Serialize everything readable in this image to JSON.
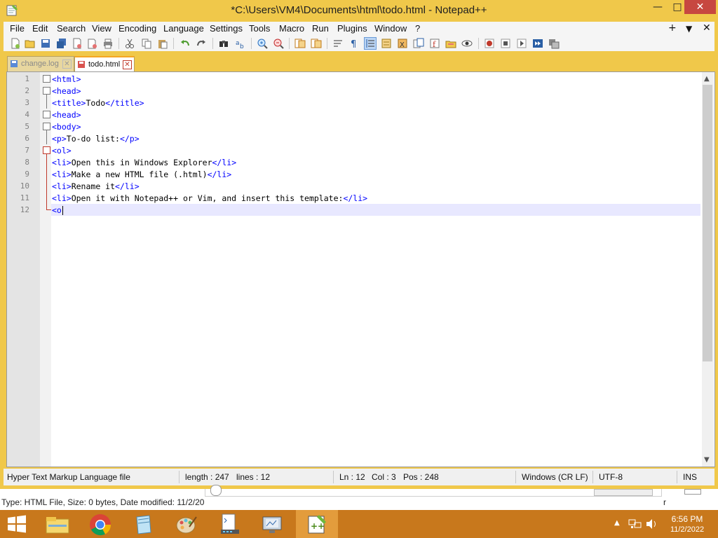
{
  "window": {
    "title": "*C:\\Users\\VM4\\Documents\\html\\todo.html - Notepad++",
    "minimize_label": "—",
    "maximize_label": "□",
    "close_label": "✕"
  },
  "menu": {
    "items": [
      "File",
      "Edit",
      "Search",
      "View",
      "Encoding",
      "Language",
      "Settings",
      "Tools",
      "Macro",
      "Run",
      "Plugins",
      "Window",
      "?"
    ],
    "right_add": "+",
    "right_dropdown": "▼",
    "right_close": "✕"
  },
  "tabs": [
    {
      "label": "change.log",
      "active": false
    },
    {
      "label": "todo.html",
      "active": true
    }
  ],
  "editor": {
    "lines": [
      {
        "num": "1",
        "parts": [
          {
            "t": "tag",
            "v": "<html>"
          }
        ]
      },
      {
        "num": "2",
        "parts": [
          {
            "t": "tag",
            "v": "<head>"
          }
        ]
      },
      {
        "num": "3",
        "parts": [
          {
            "t": "tag",
            "v": "<title>"
          },
          {
            "t": "txt",
            "v": "Todo"
          },
          {
            "t": "tag",
            "v": "</title>"
          }
        ]
      },
      {
        "num": "4",
        "parts": [
          {
            "t": "tag",
            "v": "<head>"
          }
        ]
      },
      {
        "num": "5",
        "parts": [
          {
            "t": "tag",
            "v": "<body>"
          }
        ]
      },
      {
        "num": "6",
        "parts": [
          {
            "t": "tag",
            "v": "<p>"
          },
          {
            "t": "txt",
            "v": "To-do list:"
          },
          {
            "t": "tag",
            "v": "</p>"
          }
        ]
      },
      {
        "num": "7",
        "parts": [
          {
            "t": "tag",
            "v": "<ol>"
          }
        ]
      },
      {
        "num": "8",
        "parts": [
          {
            "t": "tag",
            "v": "<li>"
          },
          {
            "t": "txt",
            "v": "Open this in Windows Explorer"
          },
          {
            "t": "tag",
            "v": "</li>"
          }
        ]
      },
      {
        "num": "9",
        "parts": [
          {
            "t": "tag",
            "v": "<li>"
          },
          {
            "t": "txt",
            "v": "Make a new HTML file (.html)"
          },
          {
            "t": "tag",
            "v": "</li>"
          }
        ]
      },
      {
        "num": "10",
        "parts": [
          {
            "t": "tag",
            "v": "<li>"
          },
          {
            "t": "txt",
            "v": "Rename it"
          },
          {
            "t": "tag",
            "v": "</li>"
          }
        ]
      },
      {
        "num": "11",
        "parts": [
          {
            "t": "tag",
            "v": "<li>"
          },
          {
            "t": "txt",
            "v": "Open it with Notepad++ or Vim, and insert this template:"
          },
          {
            "t": "tag",
            "v": "</li>"
          }
        ]
      },
      {
        "num": "12",
        "parts": [
          {
            "t": "tag",
            "v": "<o"
          }
        ]
      }
    ]
  },
  "status": {
    "file_type": "Hyper Text Markup Language file",
    "length": "length : 247",
    "lines": "lines : 12",
    "ln": "Ln : 12",
    "col": "Col : 3",
    "pos": "Pos : 248",
    "eol": "Windows (CR LF)",
    "encoding": "UTF-8",
    "mode": "INS"
  },
  "explorer": {
    "details": "Type: HTML File, Size: 0 bytes, Date modified: 11/2/20",
    "right_fragment": "r"
  },
  "taskbar": {
    "time": "6:56 PM",
    "date": "11/2/2022",
    "apps": [
      "windows-start",
      "file-explorer",
      "chrome",
      "notepad",
      "paint",
      "task-manager",
      "remote-desktop",
      "notepad-plus-plus"
    ]
  },
  "colors": {
    "titlebar": "#f0c84a",
    "taskbar": "#c8781c",
    "tag": "#0000ff",
    "current_line": "#e8e8ff"
  }
}
